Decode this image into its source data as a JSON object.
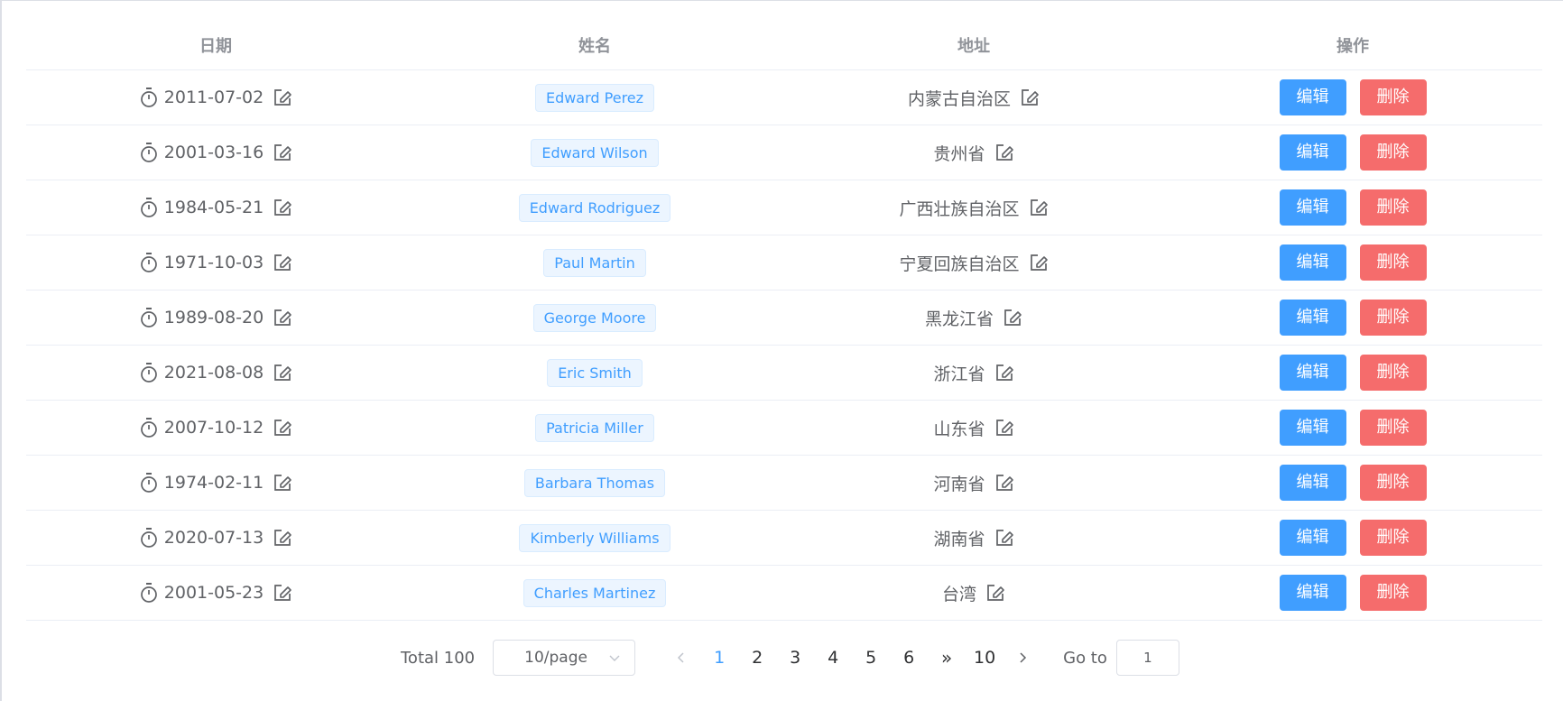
{
  "table": {
    "headers": {
      "date": "日期",
      "name": "姓名",
      "address": "地址",
      "actions": "操作"
    },
    "rows": [
      {
        "date": "2011-07-02",
        "name": "Edward Perez",
        "address": "内蒙古自治区"
      },
      {
        "date": "2001-03-16",
        "name": "Edward Wilson",
        "address": "贵州省"
      },
      {
        "date": "1984-05-21",
        "name": "Edward Rodriguez",
        "address": "广西壮族自治区"
      },
      {
        "date": "1971-10-03",
        "name": "Paul Martin",
        "address": "宁夏回族自治区"
      },
      {
        "date": "1989-08-20",
        "name": "George Moore",
        "address": "黑龙江省"
      },
      {
        "date": "2021-08-08",
        "name": "Eric Smith",
        "address": "浙江省"
      },
      {
        "date": "2007-10-12",
        "name": "Patricia Miller",
        "address": "山东省"
      },
      {
        "date": "1974-02-11",
        "name": "Barbara Thomas",
        "address": "河南省"
      },
      {
        "date": "2020-07-13",
        "name": "Kimberly Williams",
        "address": "湖南省"
      },
      {
        "date": "2001-05-23",
        "name": "Charles Martinez",
        "address": "台湾"
      }
    ],
    "edit_label": "编辑",
    "delete_label": "删除"
  },
  "pagination": {
    "total": "Total 100",
    "page_size": "10/page",
    "pages": [
      "1",
      "2",
      "3",
      "4",
      "5",
      "6"
    ],
    "more": "»",
    "last_page": "10",
    "current_page": "1",
    "goto_label": "Go to",
    "goto_value": "1"
  },
  "icons": {
    "date": "stopwatch-icon",
    "edit": "edit-icon",
    "prev": "chevron-left-icon",
    "next": "chevron-right-icon",
    "select": "chevron-down-icon"
  },
  "colors": {
    "primary": "#409eff",
    "danger": "#f56c6c",
    "text": "#606266",
    "header_text": "#909399",
    "border": "#ebeef5"
  }
}
